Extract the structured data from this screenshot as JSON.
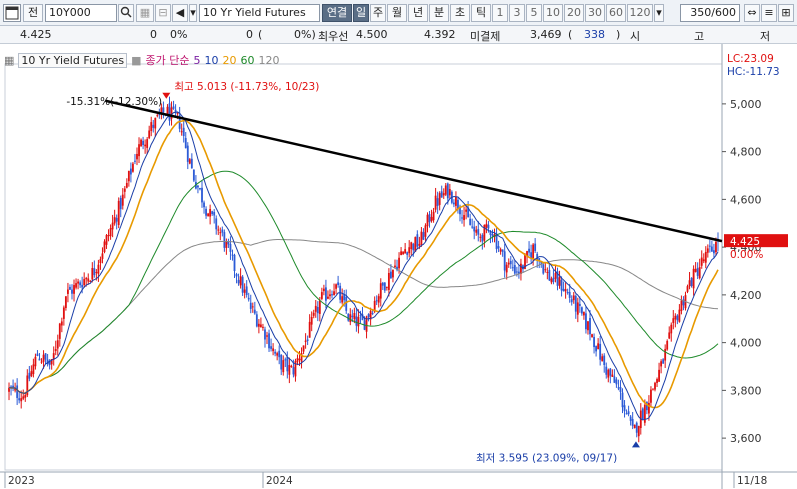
{
  "toolbar": {
    "window_icon": "window-icon",
    "type_label": "전",
    "code": "10Y000",
    "search_icon": "search-icon",
    "name_placeholder": "10 Yr Yield Futures",
    "active_tab": "연결",
    "periods": [
      "일",
      "주",
      "월",
      "년",
      "분",
      "초",
      "틱"
    ],
    "ticks": [
      "1",
      "3",
      "5",
      "10",
      "20",
      "30",
      "60",
      "120"
    ],
    "count": "350/600",
    "right_icons": [
      "zoom-icon",
      "settings-icon",
      "expand-icon"
    ]
  },
  "info": {
    "price": "4.425",
    "change": "0",
    "pct": "0%",
    "open": "0",
    "open_pct": "0%)",
    "best_bid_label": "최우선",
    "best_bid": "4.500",
    "best_ask": "4.392",
    "unsettled_label": "미결제",
    "unsettled": "3,469",
    "unsettled_chg": "338",
    "unsettled_close": ")",
    "si": "시",
    "go": "고",
    "jeo": "저"
  },
  "legend": {
    "title": "10 Yr Yield Futures",
    "price_label": "종가 단순",
    "ma": [
      {
        "label": "5",
        "color": "#7b1fa2"
      },
      {
        "label": "10",
        "color": "#1a3ea8"
      },
      {
        "label": "20",
        "color": "#e89a00"
      },
      {
        "label": "60",
        "color": "#1e8a2a"
      },
      {
        "label": "120",
        "color": "#888888"
      }
    ]
  },
  "right_tags": {
    "lc": "LC:23.09",
    "hc": "HC:-11.73",
    "last": "4.425",
    "last_pct": "0.00%"
  },
  "annotations": {
    "high_pct": "-15.31%(-12.30%)",
    "high_label": "최고 5.013 (-11.73%, 10/23)",
    "low_label": "최저 3.595 (23.09%, 09/17)"
  },
  "chart_data": {
    "type": "candlestick",
    "title": "",
    "x_labels": [
      "2023",
      "2024",
      "11/18"
    ],
    "ylim": [
      3.5,
      5.1
    ],
    "y_ticks": [
      "5,000",
      "4,800",
      "4,600",
      "4,400",
      "4,200",
      "4,000",
      "3,800",
      "3,600"
    ],
    "y_tick_values": [
      5.0,
      4.8,
      4.6,
      4.4,
      4.2,
      4.0,
      3.8,
      3.6
    ],
    "up_color": "#e01010",
    "down_color": "#2d5bd6",
    "trendline": {
      "from": [
        0.14,
        5.013
      ],
      "to": [
        1.0,
        4.425
      ]
    },
    "high": {
      "value": 5.013,
      "date": "10/23"
    },
    "low": {
      "value": 3.595,
      "date": "09/17"
    },
    "last": 4.425,
    "anchors": [
      [
        0.0,
        3.8
      ],
      [
        0.02,
        3.78
      ],
      [
        0.04,
        3.95
      ],
      [
        0.06,
        3.9
      ],
      [
        0.08,
        4.2
      ],
      [
        0.1,
        4.25
      ],
      [
        0.12,
        4.3
      ],
      [
        0.14,
        4.45
      ],
      [
        0.16,
        4.6
      ],
      [
        0.18,
        4.8
      ],
      [
        0.2,
        4.9
      ],
      [
        0.22,
        4.97
      ],
      [
        0.24,
        4.93
      ],
      [
        0.26,
        4.7
      ],
      [
        0.28,
        4.55
      ],
      [
        0.3,
        4.45
      ],
      [
        0.32,
        4.3
      ],
      [
        0.34,
        4.15
      ],
      [
        0.36,
        4.05
      ],
      [
        0.38,
        3.92
      ],
      [
        0.4,
        3.88
      ],
      [
        0.42,
        4.02
      ],
      [
        0.44,
        4.18
      ],
      [
        0.46,
        4.24
      ],
      [
        0.48,
        4.1
      ],
      [
        0.5,
        4.08
      ],
      [
        0.52,
        4.2
      ],
      [
        0.54,
        4.3
      ],
      [
        0.56,
        4.4
      ],
      [
        0.58,
        4.42
      ],
      [
        0.6,
        4.58
      ],
      [
        0.62,
        4.64
      ],
      [
        0.64,
        4.55
      ],
      [
        0.66,
        4.44
      ],
      [
        0.68,
        4.48
      ],
      [
        0.7,
        4.33
      ],
      [
        0.72,
        4.3
      ],
      [
        0.74,
        4.4
      ],
      [
        0.76,
        4.28
      ],
      [
        0.78,
        4.24
      ],
      [
        0.8,
        4.15
      ],
      [
        0.82,
        4.05
      ],
      [
        0.84,
        3.9
      ],
      [
        0.86,
        3.8
      ],
      [
        0.88,
        3.62
      ],
      [
        0.9,
        3.75
      ],
      [
        0.92,
        3.9
      ],
      [
        0.94,
        4.1
      ],
      [
        0.96,
        4.25
      ],
      [
        0.98,
        4.35
      ],
      [
        1.0,
        4.42
      ]
    ],
    "ma_colors": {
      "ma5": "#7b1fa2",
      "ma10": "#1a3ea8",
      "ma20": "#e89a00",
      "ma60": "#1e8a2a",
      "ma120": "#888888"
    }
  }
}
